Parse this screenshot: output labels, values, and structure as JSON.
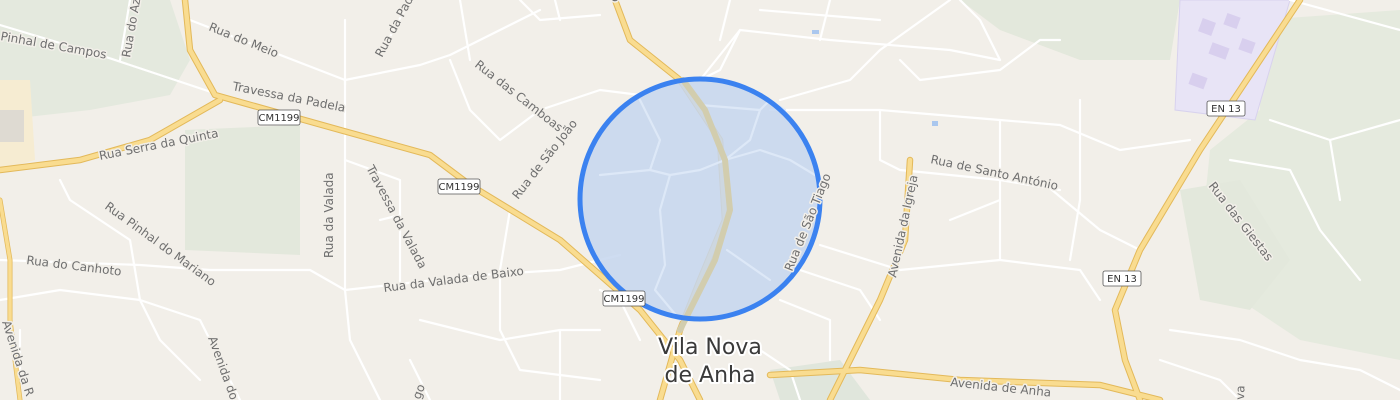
{
  "place": {
    "line1": "Vila Nova",
    "line2": "de Anha"
  },
  "streets": {
    "pinhal_campos": "Pinhal de Campos",
    "rua_do_meio": "Rua do Meio",
    "rua_do_az": "Rua do Az",
    "rua_da_padela": "Rua da Padela",
    "travessa_da_padela": "Travessa da Padela",
    "rua_das_camboas": "Rua das Camboas",
    "rua_serra_da_quinta": "Rua Serra da Quinta",
    "rua_de_sao_joao": "Rua de São João",
    "travessa_da_valada": "Travessa da Valada",
    "rua_da_valada": "Rua da Valada",
    "rua_pinhal_do_mariano": "Rua Pinhal do Mariano",
    "rua_do_canhoto": "Rua do Canhoto",
    "rua_da_valada_de_baixo": "Rua da Valada de Baixo",
    "rua_de_sao_tiago": "Rua de São Tiago",
    "rua_de_santo_antonio": "Rua de Santo António",
    "avenida_da_igreja": "Avenida da Igreja",
    "rua_das_giestas": "Rua das Giestas",
    "avenida_da_r": "Avenida da R",
    "avenida_do": "Avenida do",
    "avenida_de_anha": "Avenida de Anha",
    "real_fragment": "eal",
    "go_fragment": "go",
    "va_fragment": "va"
  },
  "shields": {
    "cm1199_a": "CM1199",
    "cm1199_b": "CM1199",
    "cm1199_c": "CM1199",
    "en13_a": "EN 13",
    "en13_b": "EN 13"
  },
  "colors": {
    "background": "#f2efe9",
    "minor_road": "#ffffff",
    "major_road": "#f7d98a",
    "major_road_casing": "#e8c067",
    "green_area": "#e3e8dc",
    "industrial": "#e8e4f6",
    "accuracy_circle_fill": "#c5d6ee",
    "accuracy_circle_stroke": "#3b82f0"
  },
  "location_marker": {
    "shape": "accuracy-circle"
  }
}
